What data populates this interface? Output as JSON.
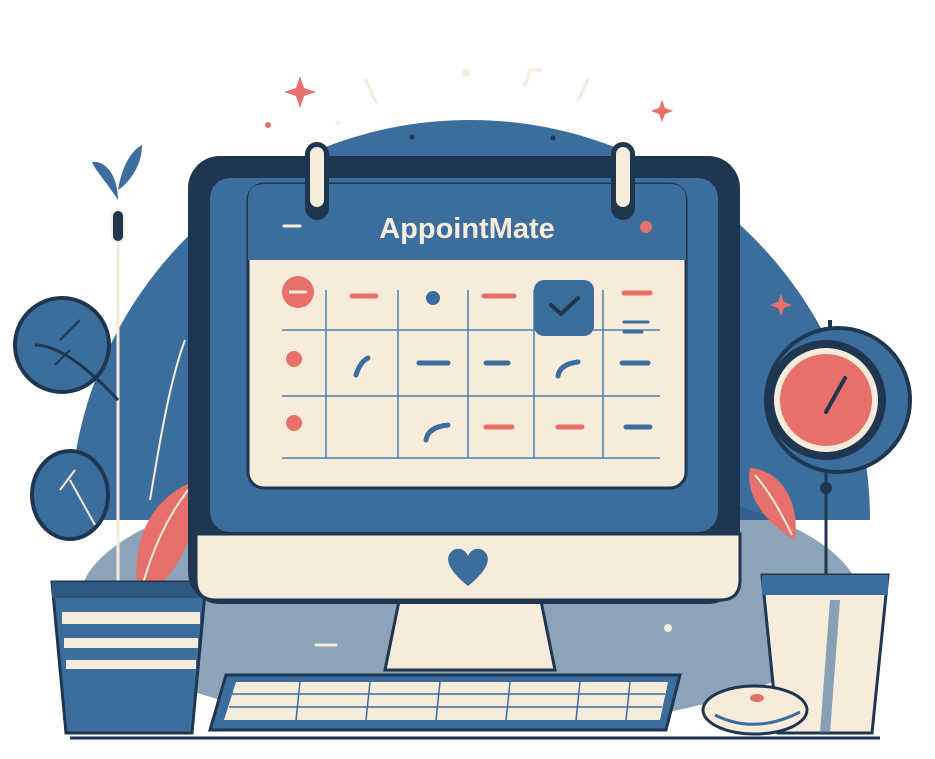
{
  "app": {
    "title": "AppointMate"
  },
  "palette": {
    "navy": "#1f3651",
    "blue": "#3b6e9c",
    "cream": "#f7ecdb",
    "coral": "#e8706a",
    "white": "#ffffff"
  },
  "icons": {
    "selected_day": "check-icon",
    "monitor_logo": "heart-icon",
    "clock": "clock-icon"
  }
}
